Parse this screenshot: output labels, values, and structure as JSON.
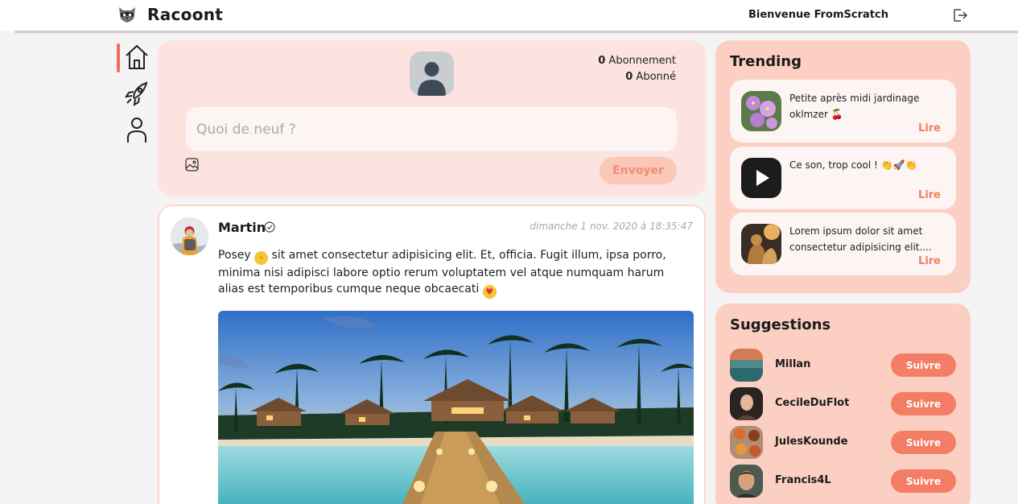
{
  "header": {
    "app_title": "Racoont",
    "logo_icon": "raccoon-logo-icon",
    "welcome": "Bienvenue FromScratch",
    "logout_icon": "logout-icon"
  },
  "nav": {
    "items": [
      {
        "name": "home",
        "icon": "home-icon",
        "active": true
      },
      {
        "name": "trending",
        "icon": "rocket-icon",
        "active": false
      },
      {
        "name": "profile",
        "icon": "user-icon",
        "active": false
      }
    ]
  },
  "composer": {
    "following_count": "0",
    "following_label": "Abonnement",
    "followers_count": "0",
    "followers_label": "Abonné",
    "placeholder": "Quoi de neuf ?",
    "send_label": "Envoyer"
  },
  "post": {
    "author": "Martin",
    "date": "dimanche 1 nov. 2020 à 18:35:47",
    "text_part1": "Posey",
    "text_part2": "sit amet consectetur adipisicing elit. Et, officia. Fugit illum, ipsa porro, minima nisi adipisci labore optio rerum voluptatem vel atque numquam harum alias est temporibus cumque neque obcaecati"
  },
  "trending": {
    "title": "Trending",
    "items": [
      {
        "text": "Petite après midi jardinage oklmzer 🍒",
        "read": "Lire"
      },
      {
        "text": "Ce son, trop cool ! 👏🚀👏",
        "read": "Lire"
      },
      {
        "text": "Lorem ipsum dolor sit amet consectetur adipisicing elit....",
        "read": "Lire"
      }
    ]
  },
  "suggestions": {
    "title": "Suggestions",
    "follow_label": "Suivre",
    "users": [
      {
        "name": "Millan"
      },
      {
        "name": "CecileDuFlot"
      },
      {
        "name": "JulesKounde"
      },
      {
        "name": "Francis4L"
      }
    ]
  },
  "colors": {
    "accent": "#f26b5b",
    "panel": "#fccfc3",
    "composer_bg": "#fde3e0",
    "follow_button": "#f47d66",
    "read_link": "#f27e5f"
  }
}
